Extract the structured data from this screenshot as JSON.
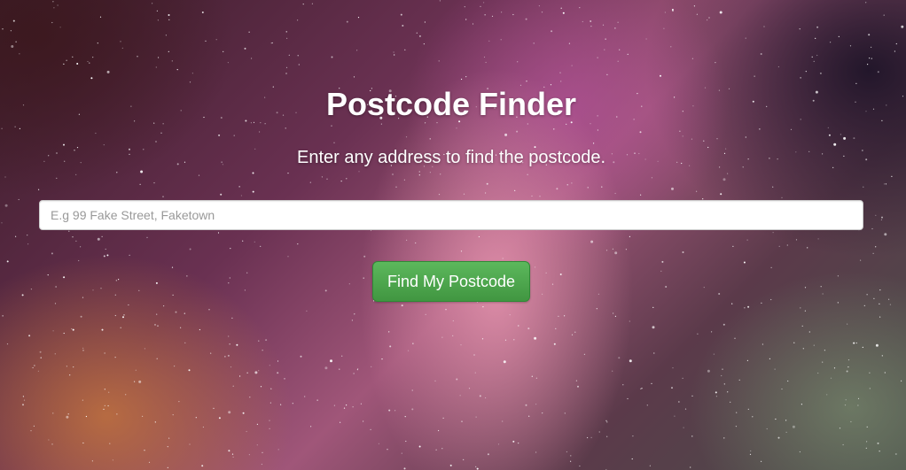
{
  "header": {
    "title": "Postcode Finder",
    "subtitle": "Enter any address to find the postcode."
  },
  "search": {
    "placeholder": "E.g 99 Fake Street, Faketown",
    "value": ""
  },
  "actions": {
    "find_label": "Find My Postcode"
  },
  "colors": {
    "button_green": "#5cb85c",
    "button_green_dark": "#419641",
    "text": "#ffffff"
  }
}
